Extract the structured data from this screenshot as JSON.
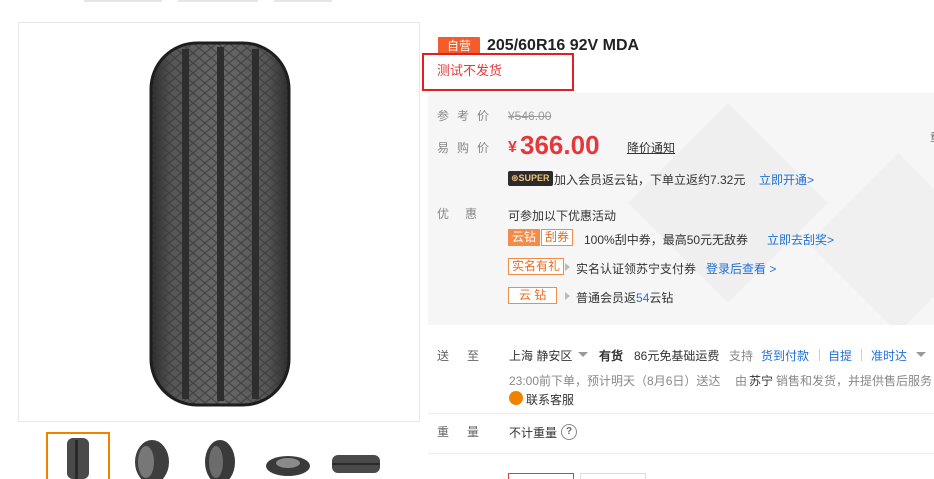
{
  "product": {
    "self_badge": "自营",
    "title": "205/60R16 92V MDA",
    "note": "测试不发货"
  },
  "price": {
    "ref_label": "参考价",
    "ref_value": "¥546.00",
    "sale_label": "易购价",
    "currency": "¥",
    "sale_value": "366.00",
    "notify_link": "降价通知",
    "super_badge": "SUPER",
    "member_text": "加入会员返云钻，下单立返约7.32元",
    "member_link": "立即开通>"
  },
  "promotions": {
    "label": "优惠",
    "intro": "可参加以下优惠活动",
    "items": [
      {
        "tag1": "云钻",
        "tag2": "刮券",
        "text": "100%刮中券，最高50元无敌券",
        "link": "立即去刮奖>"
      },
      {
        "tag1": "实名有礼",
        "text": "实名认证领苏宁支付券",
        "link": "登录后查看 >"
      },
      {
        "tag1": "云 钻",
        "text_prefix": "普通会员返",
        "highlight": "54",
        "text_suffix": "云钻"
      }
    ]
  },
  "delivery": {
    "label": "送至",
    "location": "上海 静安区",
    "stock": "有货",
    "shipping": "86元免基础运费",
    "support_label": "支持",
    "options": [
      "货到付款",
      "自提",
      "准时达"
    ],
    "timing": "23:00前下单，预计明天（8月6日）送达",
    "seller_prefix": "由",
    "seller": "苏宁",
    "seller_suffix": "销售和发货，并提供售后服务",
    "service_link": "联系客服"
  },
  "weight": {
    "label": "重量",
    "value": "不计重量",
    "help": "?"
  },
  "colors": {
    "accent_red": "#e4393c",
    "badge_orange": "#f25d2b",
    "link_blue": "#1f6fd6",
    "thumb_active": "#f08200"
  }
}
